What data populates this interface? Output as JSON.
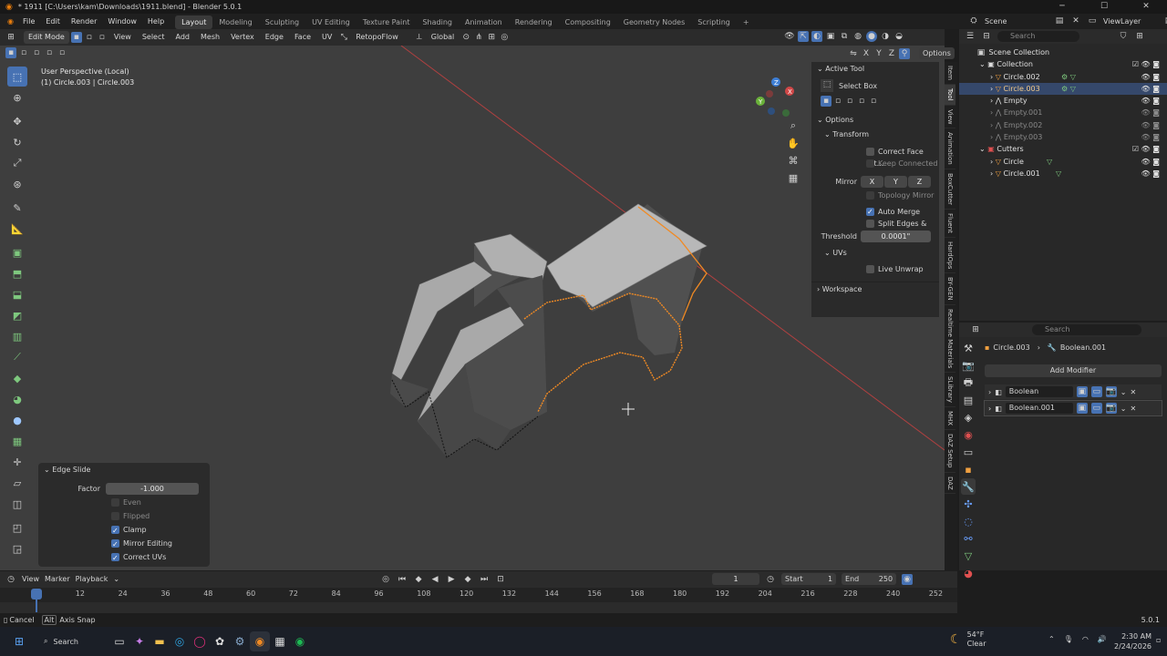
{
  "window": {
    "title": "* 1911 [C:\\Users\\kam\\Downloads\\1911.blend] - Blender 5.0.1",
    "minimize": "─",
    "maximize": "☐",
    "close": "✕"
  },
  "menu": {
    "items": [
      "File",
      "Edit",
      "Render",
      "Window",
      "Help"
    ],
    "workspaces": [
      "Layout",
      "Modeling",
      "Sculpting",
      "UV Editing",
      "Texture Paint",
      "Shading",
      "Animation",
      "Rendering",
      "Compositing",
      "Geometry Nodes",
      "Scripting",
      "+"
    ],
    "scene": "Scene",
    "view_layer": "ViewLayer"
  },
  "viewport_header": {
    "mode": "Edit Mode",
    "menus": [
      "View",
      "Select",
      "Add",
      "Mesh",
      "Vertex",
      "Edge",
      "Face",
      "UV"
    ],
    "retopo": "RetopoFlow",
    "transform": "Global",
    "options": "Options",
    "mirror_x": "X",
    "mirror_y": "Y",
    "mirror_z": "Z"
  },
  "viewport_info": {
    "line1": "User Perspective (Local)",
    "line2": "(1) Circle.003 | Circle.003"
  },
  "gizmo": {
    "x": "X",
    "y": "Y",
    "z": "Z"
  },
  "npanel": {
    "active_tool": "Active Tool",
    "tool_name": "Select Box",
    "options": "Options",
    "transform": "Transform",
    "correct_face": "Correct Face Att...",
    "keep_connected": "Keep Connected",
    "mirror": "Mirror",
    "mx": "X",
    "my": "Y",
    "mz": "Z",
    "topology_mirror": "Topology Mirror",
    "auto_merge": "Auto Merge",
    "split_edges": "Split Edges & Fa...",
    "threshold": "Threshold",
    "threshold_val": "0.0001\"",
    "uvs": "UVs",
    "live_unwrap": "Live Unwrap",
    "workspace": "Workspace",
    "tabs": [
      "Item",
      "Tool",
      "View",
      "Animation",
      "BoxCutter",
      "Fluent",
      "HardOps",
      "BY-GEN",
      "Realtime Materials",
      "SLibrary",
      "MHX",
      "DAZ Setup",
      "DAZ"
    ]
  },
  "edge_slide": {
    "title": "Edge Slide",
    "factor_label": "Factor",
    "factor": "-1.000",
    "even": "Even",
    "flipped": "Flipped",
    "clamp": "Clamp",
    "mirror_editing": "Mirror Editing",
    "correct_uvs": "Correct UVs"
  },
  "outliner": {
    "search": "Search",
    "root": "Scene Collection",
    "items": [
      {
        "label": "Collection",
        "level": 1,
        "dim": false
      },
      {
        "label": "Circle.002",
        "level": 2,
        "dim": false
      },
      {
        "label": "Circle.003",
        "level": 2,
        "dim": false
      },
      {
        "label": "Empty",
        "level": 2,
        "dim": false
      },
      {
        "label": "Empty.001",
        "level": 2,
        "dim": true
      },
      {
        "label": "Empty.002",
        "level": 2,
        "dim": true
      },
      {
        "label": "Empty.003",
        "level": 2,
        "dim": true
      },
      {
        "label": "Cutters",
        "level": 1,
        "dim": false
      },
      {
        "label": "Circle",
        "level": 2,
        "dim": false
      },
      {
        "label": "Circle.001",
        "level": 2,
        "dim": false
      }
    ]
  },
  "properties": {
    "search": "Search",
    "object": "Circle.003",
    "modifier_path": "Boolean.001",
    "add_modifier": "Add Modifier",
    "modifiers": [
      "Boolean",
      "Boolean.001"
    ]
  },
  "timeline": {
    "menus": [
      "View",
      "Marker",
      "Playback"
    ],
    "current_frame": "1",
    "start_label": "Start",
    "start": "1",
    "end_label": "End",
    "end": "250",
    "ticks": [
      "1",
      "12",
      "24",
      "36",
      "48",
      "60",
      "72",
      "84",
      "96",
      "108",
      "120",
      "132",
      "144",
      "156",
      "168",
      "180",
      "192",
      "204",
      "216",
      "228",
      "240",
      "252"
    ]
  },
  "statusbar": {
    "cancel": "Cancel",
    "alt": "Alt",
    "axis_snap": "Axis Snap",
    "version": "5.0.1"
  },
  "taskbar": {
    "search": "Search",
    "weather_temp": "54°F",
    "weather_desc": "Clear",
    "time": "2:30 AM",
    "date": "2/24/2026"
  },
  "colors": {
    "accent": "#4772b3",
    "selected_edges": "#f08a24",
    "viewport_bg": "#3e3e3e",
    "xaxis": "#c84444"
  }
}
